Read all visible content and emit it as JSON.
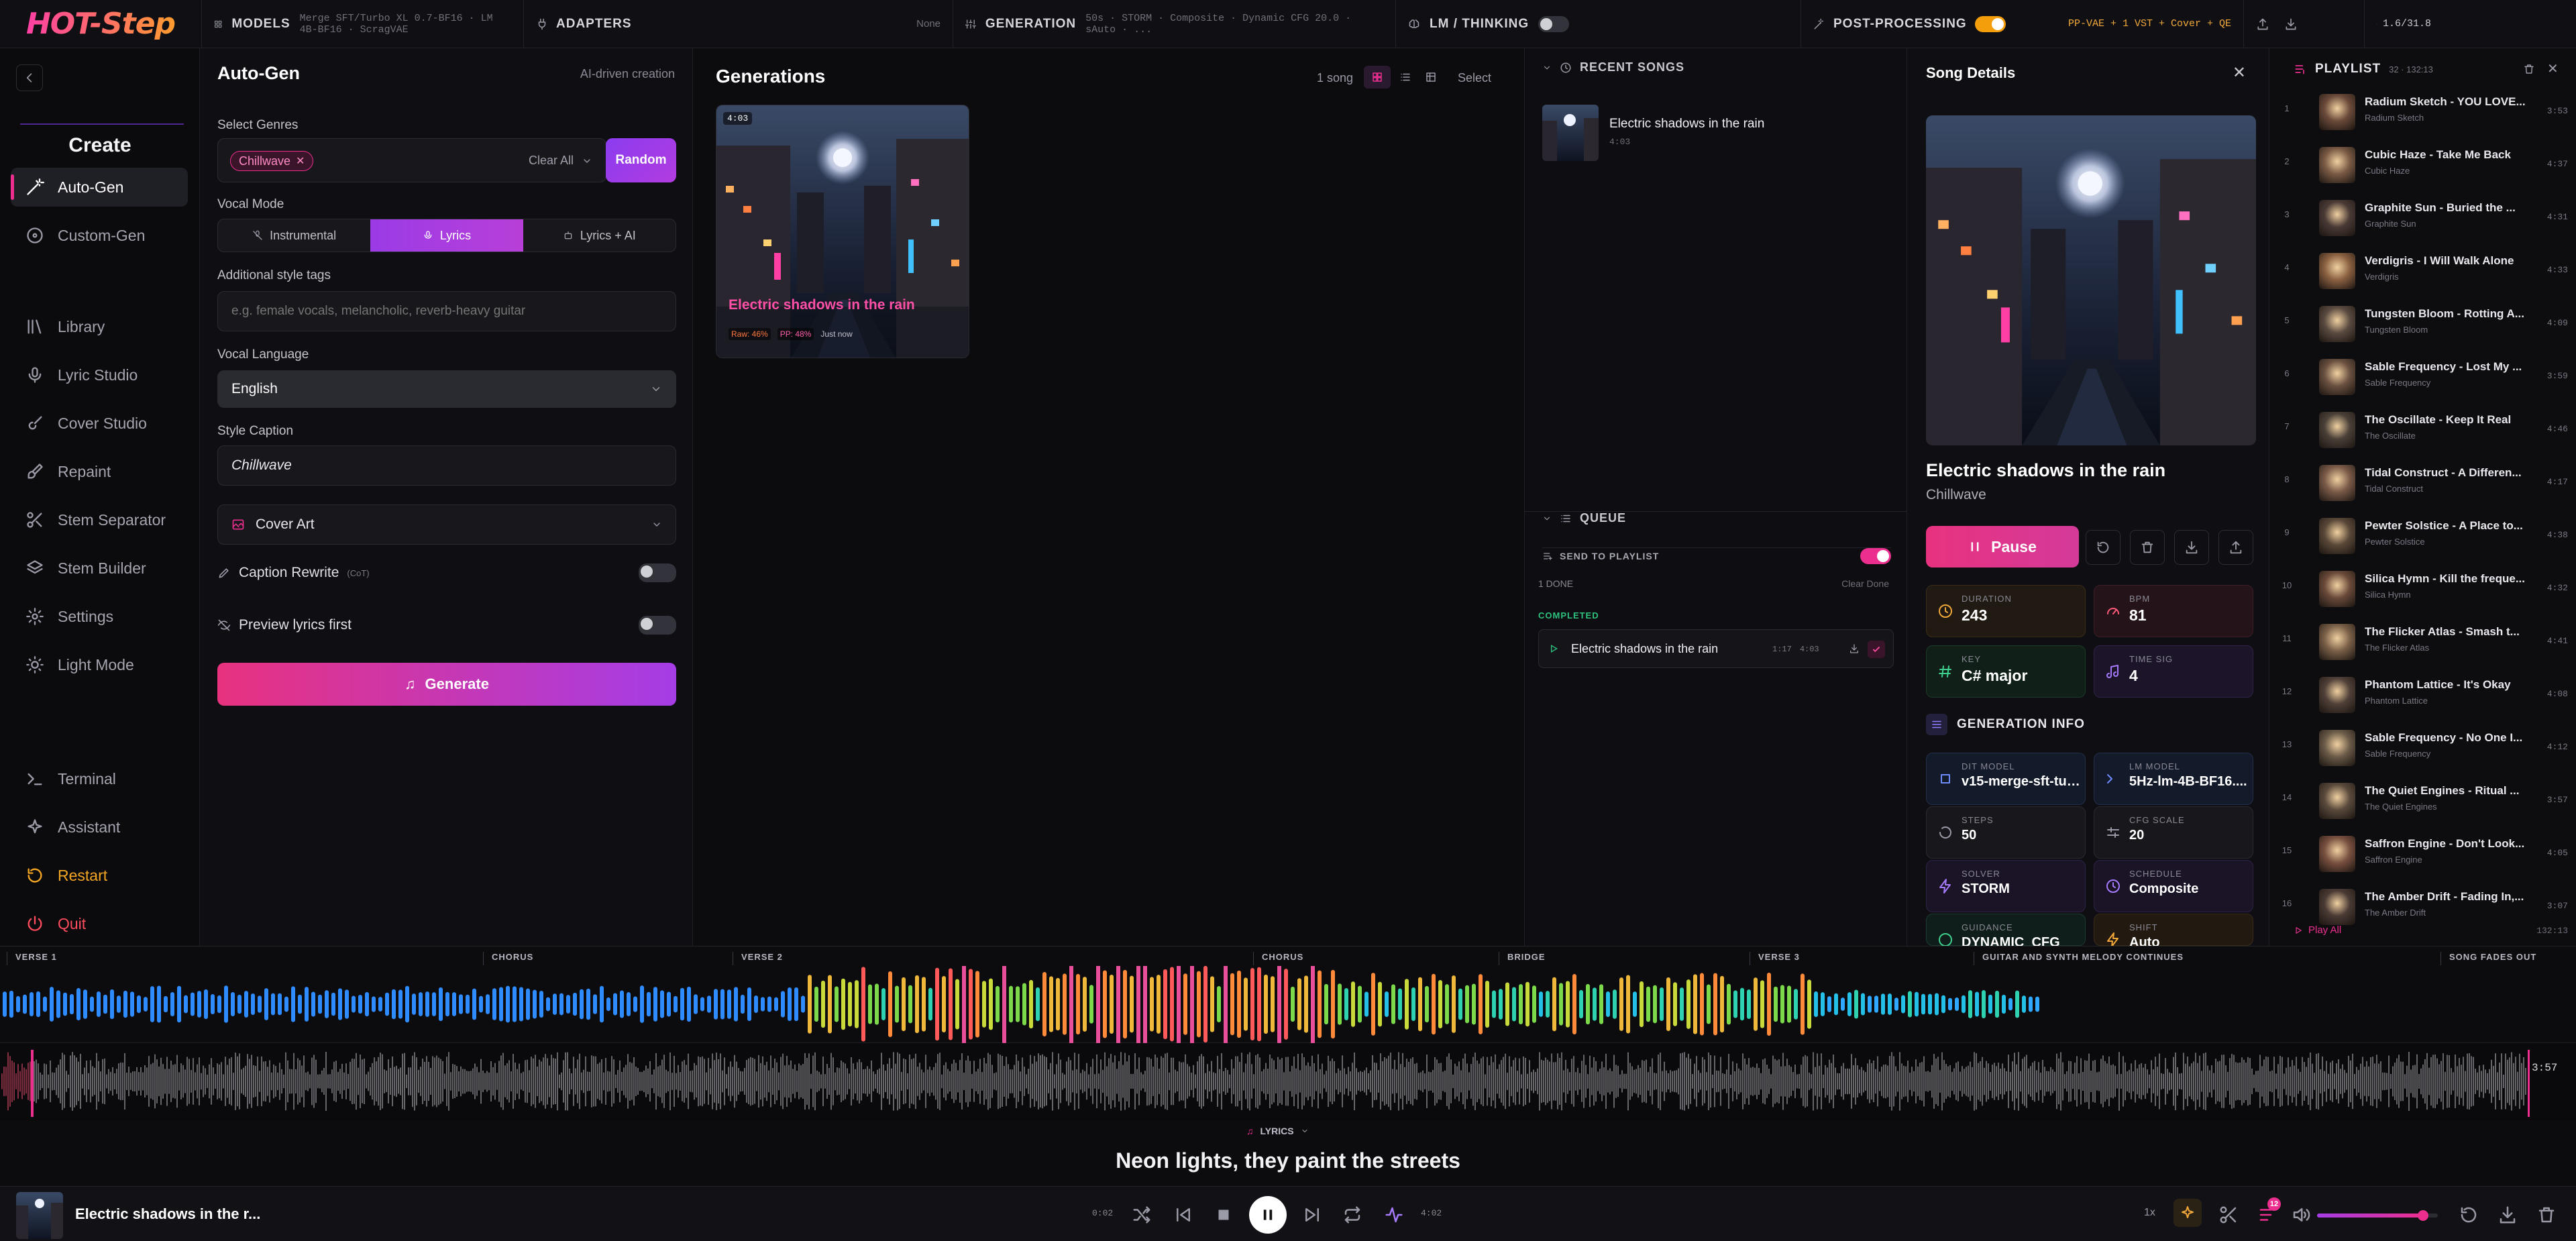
{
  "topbar": {
    "logo": "HOT-Step",
    "models_label": "MODELS",
    "models_value": "Merge SFT/Turbo XL 0.7-BF16 · LM 4B-BF16 · ScragVAE",
    "adapters_label": "ADAPTERS",
    "adapters_value": "None",
    "generation_label": "GENERATION",
    "generation_value": "50s · STORM · Composite · Dynamic CFG 20.0 · sAuto · ...",
    "lm_label": "LM / THINKING",
    "post_label": "POST-PROCESSING",
    "post_value": "PP-VAE + 1 VST + Cover + QE",
    "version": "1.6/31.8"
  },
  "sidebar": {
    "section_title": "Create",
    "items": [
      {
        "label": "Auto-Gen",
        "icon": "magic-wand-icon"
      },
      {
        "label": "Custom-Gen",
        "icon": "disc-icon"
      },
      {
        "label": "Library",
        "icon": "library-icon"
      },
      {
        "label": "Lyric Studio",
        "icon": "microphone-icon"
      },
      {
        "label": "Cover Studio",
        "icon": "guitar-icon"
      },
      {
        "label": "Repaint",
        "icon": "brush-icon"
      },
      {
        "label": "Stem Separator",
        "icon": "scissors-icon"
      },
      {
        "label": "Stem Builder",
        "icon": "layers-icon"
      },
      {
        "label": "Settings",
        "icon": "gear-icon"
      },
      {
        "label": "Light Mode",
        "icon": "sun-icon"
      }
    ],
    "bottom_items": [
      {
        "label": "Terminal",
        "icon": "terminal-icon"
      },
      {
        "label": "Assistant",
        "icon": "sparkle-icon"
      },
      {
        "label": "Restart",
        "icon": "restart-icon"
      },
      {
        "label": "Quit",
        "icon": "power-icon"
      }
    ]
  },
  "autogen": {
    "title": "Auto-Gen",
    "subtitle": "AI-driven creation",
    "genres_label": "Select Genres",
    "genre_chip": "Chillwave",
    "clear_all": "Clear All",
    "random": "Random",
    "vocal_mode_label": "Vocal Mode",
    "vocal_modes": [
      "Instrumental",
      "Lyrics",
      "Lyrics + AI"
    ],
    "style_tags_label": "Additional style tags",
    "style_tags_placeholder": "e.g. female vocals, melancholic, reverb-heavy guitar",
    "language_label": "Vocal Language",
    "language_value": "English",
    "caption_label": "Style Caption",
    "caption_value": "Chillwave",
    "cover_art": "Cover Art",
    "caption_rewrite": "Caption Rewrite",
    "caption_rewrite_tag": "(CoT)",
    "preview_lyrics": "Preview lyrics first",
    "generate": "Generate"
  },
  "generations": {
    "title": "Generations",
    "count": "1 song",
    "select": "Select",
    "card": {
      "duration": "4:03",
      "title": "Electric shadows in the rain",
      "raw": "Raw: 46%",
      "pp": "PP: 48%",
      "time": "Just now"
    }
  },
  "recent": {
    "title": "RECENT SONGS",
    "song_title": "Electric shadows in the rain",
    "song_duration": "4:03"
  },
  "queue": {
    "title": "QUEUE",
    "send_to_playlist": "SEND TO PLAYLIST",
    "done_count": "1 DONE",
    "clear_done": "Clear Done",
    "completed_label": "COMPLETED",
    "item_title": "Electric shadows in the rain",
    "item_gen_time": "1:17",
    "item_duration": "4:03"
  },
  "details": {
    "title": "Song Details",
    "song_title": "Electric shadows in the rain",
    "genre": "Chillwave",
    "pause": "Pause",
    "stats": [
      {
        "k": "DURATION",
        "v": "243"
      },
      {
        "k": "BPM",
        "v": "81"
      },
      {
        "k": "KEY",
        "v": "C# major"
      },
      {
        "k": "TIME SIG",
        "v": "4"
      }
    ],
    "gen_info_title": "GENERATION INFO",
    "gen_info": [
      {
        "k": "DIT MODEL",
        "v": "v15-merge-sft-tur..."
      },
      {
        "k": "LM MODEL",
        "v": "5Hz-lm-4B-BF16...."
      },
      {
        "k": "STEPS",
        "v": "50"
      },
      {
        "k": "CFG SCALE",
        "v": "20"
      },
      {
        "k": "SOLVER",
        "v": "STORM"
      },
      {
        "k": "SCHEDULE",
        "v": "Composite"
      },
      {
        "k": "GUIDANCE",
        "v": "DYNAMIC_CFG"
      },
      {
        "k": "SHIFT",
        "v": "Auto"
      }
    ]
  },
  "playlist": {
    "title": "PLAYLIST",
    "meta": "32 · 132:13",
    "play_all": "Play All",
    "total": "132:13",
    "items": [
      {
        "t": "Radium Sketch - YOU LOVE...",
        "a": "Radium Sketch",
        "d": "3:53"
      },
      {
        "t": "Cubic Haze - Take Me Back",
        "a": "Cubic Haze",
        "d": "4:37"
      },
      {
        "t": "Graphite Sun - Buried the ...",
        "a": "Graphite Sun",
        "d": "4:31"
      },
      {
        "t": "Verdigris - I Will Walk Alone",
        "a": "Verdigris",
        "d": "4:33"
      },
      {
        "t": "Tungsten Bloom - Rotting A...",
        "a": "Tungsten Bloom",
        "d": "4:09"
      },
      {
        "t": "Sable Frequency - Lost My ...",
        "a": "Sable Frequency",
        "d": "3:59"
      },
      {
        "t": "The Oscillate - Keep It Real",
        "a": "The Oscillate",
        "d": "4:46"
      },
      {
        "t": "Tidal Construct - A Differen...",
        "a": "Tidal Construct",
        "d": "4:17"
      },
      {
        "t": "Pewter Solstice - A Place to...",
        "a": "Pewter Solstice",
        "d": "4:38"
      },
      {
        "t": "Silica Hymn - Kill the freque...",
        "a": "Silica Hymn",
        "d": "4:32"
      },
      {
        "t": "The Flicker Atlas - Smash t...",
        "a": "The Flicker Atlas",
        "d": "4:41"
      },
      {
        "t": "Phantom Lattice - It's Okay",
        "a": "Phantom Lattice",
        "d": "4:08"
      },
      {
        "t": "Sable Frequency - No One I...",
        "a": "Sable Frequency",
        "d": "4:12"
      },
      {
        "t": "The Quiet Engines - Ritual ...",
        "a": "The Quiet Engines",
        "d": "3:57"
      },
      {
        "t": "Saffron Engine - Don't Look...",
        "a": "Saffron Engine",
        "d": "4:05"
      },
      {
        "t": "The Amber Drift - Fading In,...",
        "a": "The Amber Drift",
        "d": "3:07"
      }
    ]
  },
  "sections": [
    "VERSE 1",
    "CHORUS",
    "VERSE 2",
    "CHORUS",
    "BRIDGE",
    "VERSE 3",
    "GUITAR AND SYNTH MELODY CONTINUES",
    "SONG FADES OUT"
  ],
  "overview_end_time": "3:57",
  "lyrics": {
    "label": "LYRICS",
    "line": "Neon lights, they paint the streets"
  },
  "player": {
    "title": "Electric shadows in the r...",
    "elapsed": "0:02",
    "total": "4:02",
    "speed": "1x",
    "badge": "12",
    "volume": 0.88
  },
  "colors": {
    "accent": "#ec2f8f",
    "accent2": "#a03ce8",
    "orange": "#f59e0b"
  }
}
